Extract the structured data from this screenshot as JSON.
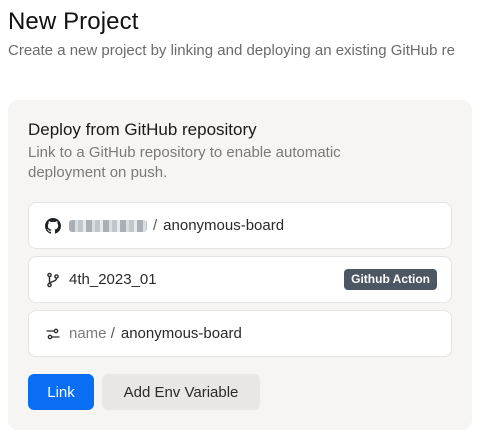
{
  "header": {
    "title": "New Project",
    "subtitle": "Create a new project by linking and deploying an existing GitHub re"
  },
  "card": {
    "title": "Deploy from GitHub repository",
    "description": "Link to a GitHub repository to enable automatic deployment on push.",
    "repo": {
      "icon": "github-icon",
      "separator": "/",
      "name": "anonymous-board"
    },
    "branch": {
      "icon": "git-branch-icon",
      "name": "4th_2023_01",
      "badge": "Github Action",
      "badge_color": "#4d5663"
    },
    "project_name": {
      "icon": "sliders-icon",
      "label": "name",
      "separator": "/",
      "value": "anonymous-board"
    }
  },
  "actions": {
    "link_label": "Link",
    "link_color": "#0a6ef5",
    "env_label": "Add Env Variable"
  }
}
